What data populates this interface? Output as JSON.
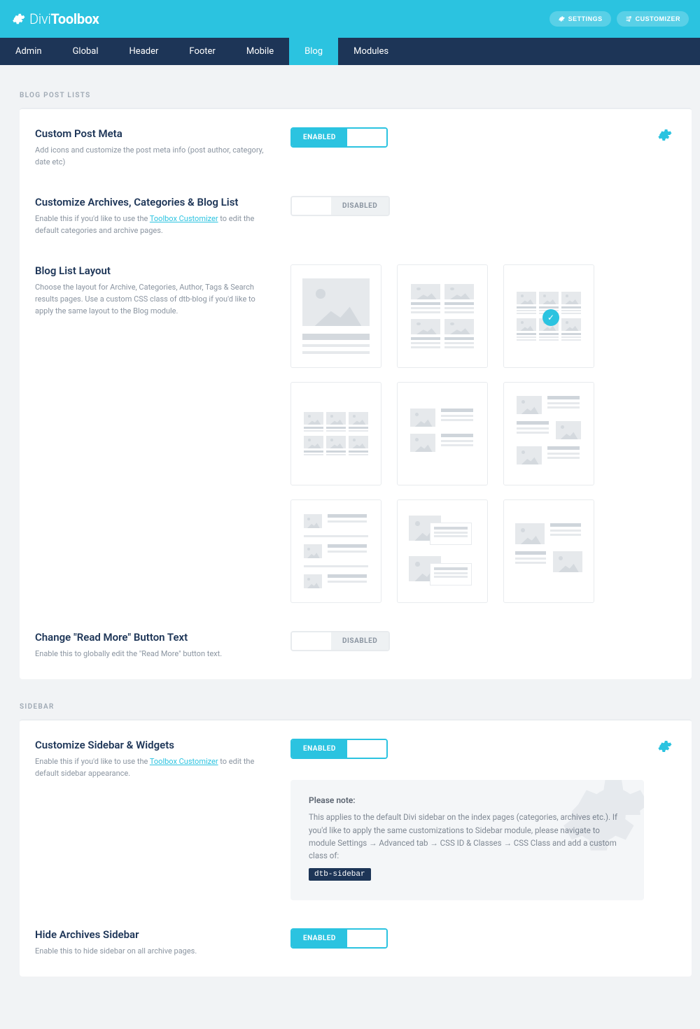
{
  "header": {
    "logo_thin": "Divi",
    "logo_bold": "Toolbox",
    "settings_btn": "SETTINGS",
    "customizer_btn": "CUSTOMIZER"
  },
  "tabs": [
    "Admin",
    "Global",
    "Header",
    "Footer",
    "Mobile",
    "Blog",
    "Modules"
  ],
  "active_tab": "Blog",
  "sections": {
    "blog_posts": {
      "label": "BLOG POST LISTS",
      "custom_post_meta": {
        "title": "Custom Post Meta",
        "desc": "Add icons and customize the post meta info (post author, category, date etc)",
        "toggle": "ENABLED"
      },
      "customize_archives": {
        "title": "Customize Archives, Categories & Blog List",
        "desc_pre": "Enable this if you'd like to use the ",
        "desc_link": "Toolbox Customizer",
        "desc_post": " to edit the default categories and archive pages.",
        "toggle": "DISABLED"
      },
      "blog_list_layout": {
        "title": "Blog List Layout",
        "desc": "Choose the layout for Archive, Categories, Author, Tags & Search results pages. Use a custom CSS class of dtb-blog if you'd like to apply the same layout to the Blog module."
      },
      "read_more": {
        "title": "Change \"Read More\" Button Text",
        "desc": "Enable this to globally edit the \"Read More\" button text.",
        "toggle": "DISABLED"
      }
    },
    "sidebar": {
      "label": "SIDEBAR",
      "customize_sidebar": {
        "title": "Customize Sidebar & Widgets",
        "desc_pre": "Enable this if you'd like to use the ",
        "desc_link": "Toolbox Customizer",
        "desc_post": " to edit the default sidebar appearance.",
        "toggle": "ENABLED",
        "note_title": "Please note:",
        "note_text": "This applies to the default Divi sidebar on the index pages (categories, archives etc.). If you'd like to apply the same customizations to Sidebar module, please navigate to module Settings → Advanced tab → CSS ID & Classes → CSS Class and add a custom class of:",
        "note_code": "dtb-sidebar"
      },
      "hide_archives": {
        "title": "Hide Archives Sidebar",
        "desc": "Enable this to hide sidebar on all archive pages.",
        "toggle": "ENABLED"
      }
    }
  }
}
